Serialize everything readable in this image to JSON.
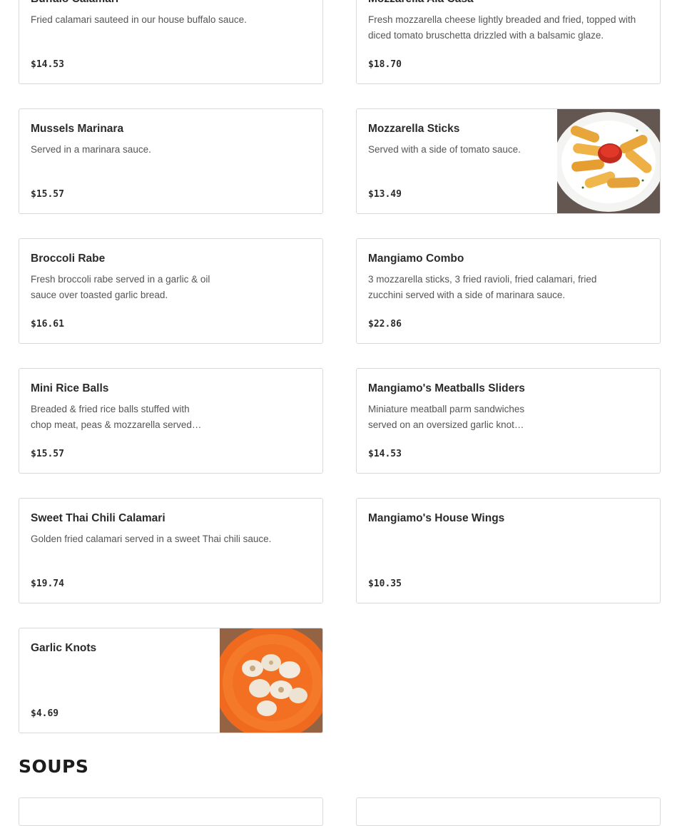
{
  "menu_items": [
    {
      "name": "Buffalo Calamari",
      "description": "Fried calamari sauteed in our house buffalo sauce.",
      "price": "$14.53"
    },
    {
      "name": "Mozzarella Ala Casa",
      "description": "Fresh mozzarella cheese lightly breaded and fried, topped with diced tomato bruschetta drizzled with a balsamic glaze.",
      "price": "$18.70"
    },
    {
      "name": "Mussels Marinara",
      "description": "Served in a marinara sauce.",
      "price": "$15.57"
    },
    {
      "name": "Mozzarella Sticks",
      "description": "Served with a side of tomato sauce.",
      "price": "$13.49",
      "image": "mozzarella-sticks-photo"
    },
    {
      "name": "Broccoli Rabe",
      "description": "Fresh broccoli rabe served in a garlic & oil sauce over toasted garlic bread.",
      "price": "$16.61"
    },
    {
      "name": "Mangiamo Combo",
      "description": "3 mozzarella sticks, 3 fried ravioli, fried calamari, fried zucchini served with a side of marinara sauce.",
      "price": "$22.86"
    },
    {
      "name": "Mini Rice Balls",
      "description": "Breaded & fried rice balls stuffed with chop meat, peas & mozzarella served…",
      "price": "$15.57"
    },
    {
      "name": "Mangiamo's Meatballs Sliders",
      "description": "Miniature meatball parm sandwiches served on an oversized garlic knot…",
      "price": "$14.53"
    },
    {
      "name": "Sweet Thai Chili Calamari",
      "description": "Golden fried calamari served in a sweet Thai chili sauce.",
      "price": "$19.74"
    },
    {
      "name": "Mangiamo's House Wings",
      "description": "",
      "price": "$10.35"
    },
    {
      "name": "Garlic Knots",
      "description": "",
      "price": "$4.69",
      "image": "garlic-knots-photo"
    }
  ],
  "sections": {
    "soups_title": "SOUPS"
  }
}
